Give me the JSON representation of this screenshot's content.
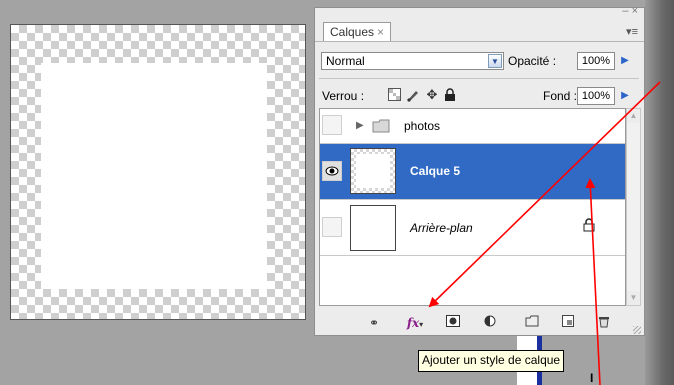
{
  "panel": {
    "tab_label": "Calques",
    "tab_close": "×",
    "window_controls": "– ×",
    "menu_icon": "▾≡",
    "blend_mode": "Normal",
    "opacity_label": "Opacité :",
    "opacity_value": "100%",
    "lock_label": "Verrou :",
    "fill_label": "Fond :",
    "fill_value": "100%",
    "lock_icons": [
      "lock-transparent-icon",
      "lock-paint-icon",
      "lock-move-icon",
      "lock-all-icon"
    ],
    "layers": [
      {
        "name": "photos",
        "type": "group",
        "visible": false,
        "selected": false
      },
      {
        "name": "Calque 5",
        "type": "layer",
        "visible": true,
        "selected": true
      },
      {
        "name": "Arrière-plan",
        "type": "background",
        "visible": false,
        "selected": false,
        "locked": true
      }
    ],
    "bottom_icons": [
      "link-icon",
      "fx-icon",
      "mask-icon",
      "adjustment-icon",
      "group-folder-icon",
      "new-layer-icon",
      "trash-icon"
    ]
  },
  "tooltip": {
    "text": "Ajouter un style de calque"
  },
  "colors": {
    "selection": "#316ac5",
    "annotation_arrow": "#ff0000",
    "fx": "#8a1d8a"
  }
}
